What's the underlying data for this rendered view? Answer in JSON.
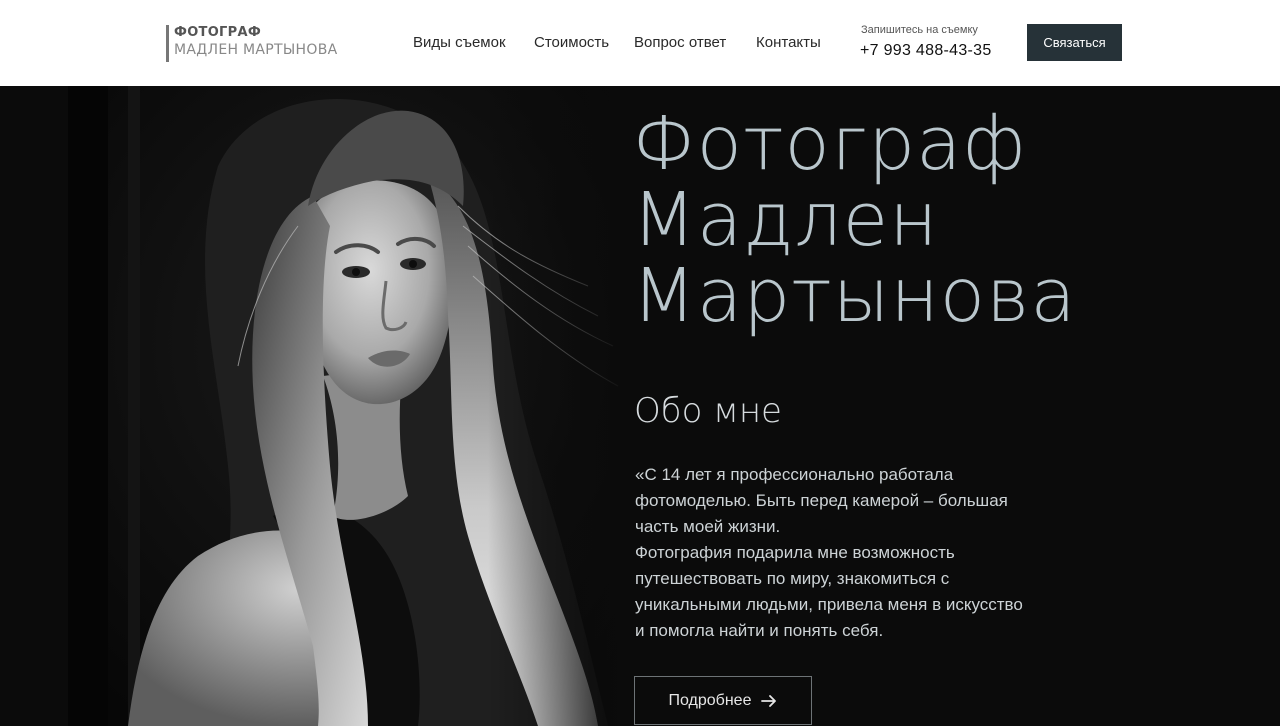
{
  "header": {
    "logo": {
      "line1": "ФОТОГРАФ",
      "line2": "МАДЛЕН МАРТЫНОВА"
    },
    "nav": [
      {
        "label": "Виды съемок"
      },
      {
        "label": "Стоимость"
      },
      {
        "label": "Вопрос ответ"
      },
      {
        "label": "Контакты"
      }
    ],
    "booking": {
      "caption": "Запишитесь на съемку",
      "phone": "+7 993 488-43-35"
    },
    "contact_button": "Связаться"
  },
  "hero": {
    "title_lines": [
      "Фотограф",
      "Мадлен",
      "Мартынова"
    ],
    "about_heading": "Обо мне",
    "about_paragraphs": [
      "«С 14 лет я профессионально работала фотомоделью. Быть перед камерой – большая часть моей жизни.",
      "Фотография подарила мне возможность путешествовать по миру, знакомиться с уникальными людьми, привела меня в искусство и помогла найти и понять себя."
    ],
    "more_button": "Подробнее",
    "more_icon": "arrow-right-icon",
    "photo_alt": "black-and-white portrait of a woman with long hair"
  },
  "colors": {
    "header_bg": "#ffffff",
    "hero_bg": "#0b0b0b",
    "accent_button": "#263238",
    "title_color": "#b9c6cc"
  }
}
